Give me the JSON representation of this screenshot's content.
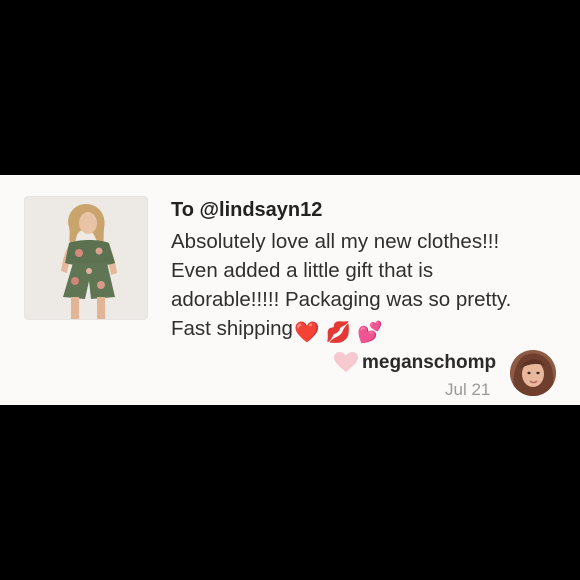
{
  "comment": {
    "recipient": "To @lindsayn12",
    "review_lines": [
      "Absolutely love all my new clothes!!!",
      "Even added a little gift that is",
      "adorable!!!!! Packaging was so pretty.",
      "Fast shipping"
    ],
    "emojis": [
      "❤️",
      "💋",
      "💕"
    ],
    "username": "meganschomp",
    "date": "Jul 21"
  },
  "icons": {
    "like": "heart-icon",
    "product_image": "product-thumbnail",
    "avatar": "user-avatar"
  },
  "colors": {
    "background": "#000000",
    "card": "#fcf9f9",
    "heart": "#f6c9d0",
    "text": "#2f2f2f",
    "muted": "#9a9a9a"
  }
}
